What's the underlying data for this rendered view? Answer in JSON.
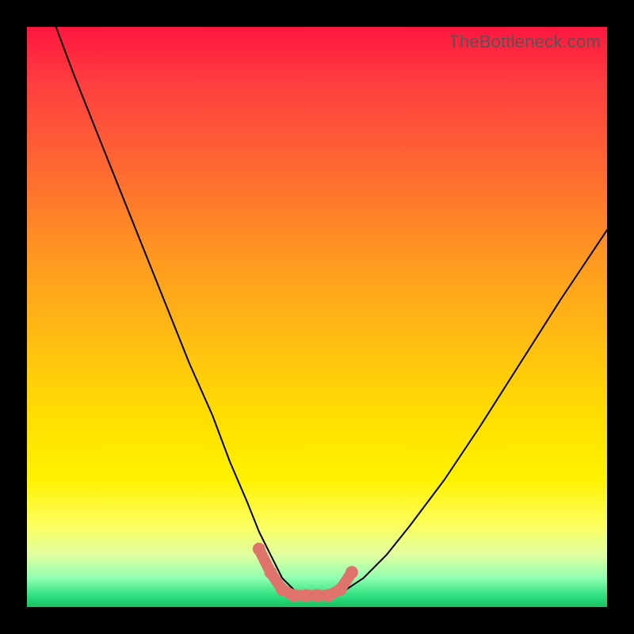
{
  "watermark": "TheBottleneck.com",
  "colors": {
    "background": "#000000",
    "curve": "#000000",
    "markers": "#e0746d"
  },
  "chart_data": {
    "type": "line",
    "title": "",
    "xlabel": "",
    "ylabel": "",
    "xlim": [
      0,
      100
    ],
    "ylim": [
      0,
      100
    ],
    "grid": false,
    "legend": false,
    "note": "Axis units are percent of plot width/height; y=0 at bottom, y=100 at top. Values estimated from pixels.",
    "series": [
      {
        "name": "bottleneck-curve",
        "x": [
          5,
          8,
          12,
          16,
          20,
          24,
          28,
          32,
          35,
          38,
          40,
          42,
          44,
          46,
          48,
          50,
          52,
          55,
          58,
          62,
          66,
          72,
          78,
          85,
          92,
          100
        ],
        "y": [
          100,
          92,
          82,
          72,
          62,
          52,
          42,
          33,
          25,
          18,
          13,
          9,
          5,
          3,
          2,
          2,
          2,
          3,
          5,
          9,
          14,
          22,
          31,
          42,
          53,
          65
        ]
      }
    ],
    "highlight_segment": {
      "name": "optimal-range-markers",
      "x": [
        40,
        42,
        44,
        46,
        48,
        50,
        52,
        54,
        56
      ],
      "y": [
        10,
        6,
        3,
        2,
        2,
        2,
        2,
        3,
        6
      ]
    }
  }
}
